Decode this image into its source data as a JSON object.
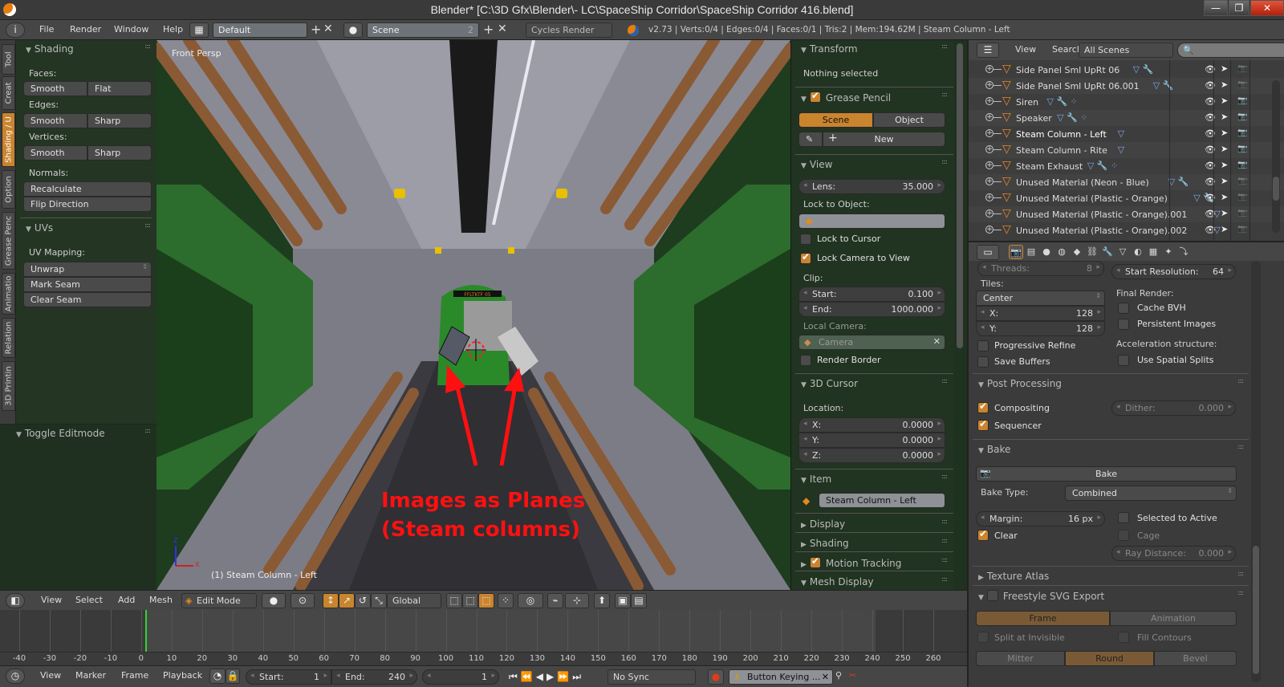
{
  "window": {
    "title": "Blender* [C:\\3D Gfx\\Blender\\- LC\\SpaceShip Corridor\\SpaceShip Corridor 416.blend]",
    "minimize": "—",
    "restore": "❐",
    "close": "✕"
  },
  "info_header": {
    "editor_icon": "i",
    "menus": [
      "File",
      "Render",
      "Window",
      "Help"
    ],
    "screen_layout": "Default",
    "scene": "Scene",
    "scene_users": "2",
    "render_engine": "Cycles Render",
    "stats": "v2.73 | Verts:0/4 | Edges:0/4 | Faces:0/1 | Tris:2 | Mem:194.62M | Steam Column - Left"
  },
  "toolshelf": {
    "tabs": [
      "Tool",
      "Creat",
      "Shading / U",
      "Option",
      "Grease Penc",
      "Animatio",
      "Relation",
      "3D Printin"
    ],
    "active_tab": "Shading / U",
    "shading_panel": {
      "title": "Shading",
      "faces_label": "Faces:",
      "faces_buttons": [
        "Smooth",
        "Flat"
      ],
      "edges_label": "Edges:",
      "edges_buttons": [
        "Smooth",
        "Sharp"
      ],
      "vertices_label": "Vertices:",
      "vertices_buttons": [
        "Smooth",
        "Sharp"
      ],
      "normals_label": "Normals:",
      "recalculate": "Recalculate",
      "flip_direction": "Flip Direction"
    },
    "uvs_panel": {
      "title": "UVs",
      "uv_mapping_label": "UV Mapping:",
      "unwrap": "Unwrap",
      "mark_seam": "Mark Seam",
      "clear_seam": "Clear Seam"
    },
    "operator_panel": {
      "title": "Toggle Editmode"
    }
  },
  "viewport": {
    "view_name": "Front Persp",
    "object_info": "(1) Steam Column - Left",
    "axis_z": "Z",
    "axis_x": "X",
    "annotation_line1": "Images as Planes",
    "annotation_line2": "(Steam columns)",
    "annotation_color": "#ff1010",
    "sign_text": "FFLTKTF 05"
  },
  "npanel": {
    "transform": {
      "title": "Transform",
      "status": "Nothing selected"
    },
    "grease_pencil": {
      "title": "Grease Pencil",
      "enabled": true,
      "tabs": [
        "Scene",
        "Object"
      ],
      "active_tab": "Scene",
      "new_label": "New"
    },
    "view": {
      "title": "View",
      "lens_label": "Lens:",
      "lens_value": "35.000",
      "lock_to_object_label": "Lock to Object:",
      "lock_to_cursor_label": "Lock to Cursor",
      "lock_to_cursor": false,
      "lock_camera_label": "Lock Camera to View",
      "lock_camera": true,
      "clip_label": "Clip:",
      "clip_start_label": "Start:",
      "clip_start": "0.100",
      "clip_end_label": "End:",
      "clip_end": "1000.000",
      "local_camera_label": "Local Camera:",
      "local_camera_value": "Camera",
      "render_border_label": "Render Border",
      "render_border": false
    },
    "cursor": {
      "title": "3D Cursor",
      "location_label": "Location:",
      "x_label": "X:",
      "x": "0.0000",
      "y_label": "Y:",
      "y": "0.0000",
      "z_label": "Z:",
      "z": "0.0000"
    },
    "item": {
      "title": "Item",
      "name": "Steam Column - Left"
    },
    "display": {
      "title": "Display"
    },
    "shading": {
      "title": "Shading"
    },
    "motion_tracking": {
      "title": "Motion Tracking",
      "enabled": true
    },
    "mesh_display": {
      "title": "Mesh Display"
    }
  },
  "v3d_header": {
    "menus": [
      "View",
      "Select",
      "Add",
      "Mesh"
    ],
    "mode": "Edit Mode",
    "orientation": "Global"
  },
  "timeline": {
    "ticks": [
      "-40",
      "-30",
      "-20",
      "-10",
      "0",
      "10",
      "20",
      "30",
      "40",
      "50",
      "60",
      "70",
      "80",
      "90",
      "100",
      "110",
      "120",
      "130",
      "140",
      "150",
      "160",
      "170",
      "180",
      "190",
      "200",
      "210",
      "220",
      "230",
      "240",
      "250",
      "260"
    ],
    "current_frame_marker": "0",
    "menus": [
      "View",
      "Marker",
      "Frame",
      "Playback"
    ],
    "start_label": "Start:",
    "start": "1",
    "end_label": "End:",
    "end": "240",
    "current_frame": "1",
    "sync": "No Sync",
    "keying_set": "Button Keying ..."
  },
  "outliner": {
    "view_menu": "View",
    "search_menu": "Search",
    "display_mode": "All Scenes",
    "search_placeholder": "",
    "rows": [
      {
        "name": "Side Panel Sml UpRt 06",
        "extras": "▽ 🔧",
        "renderable": false
      },
      {
        "name": "Side Panel Sml UpRt 06.001",
        "extras": "▽ 🔧",
        "renderable": false
      },
      {
        "name": "Siren",
        "extras": "▽ 🔧 ⁘",
        "renderable": true
      },
      {
        "name": "Speaker",
        "extras": "▽ 🔧 ⁘",
        "renderable": true
      },
      {
        "name": "Steam Column - Left",
        "extras": "▽",
        "renderable": true
      },
      {
        "name": "Steam Column - Rite",
        "extras": "▽",
        "renderable": true
      },
      {
        "name": "Steam Exhaust",
        "extras": "▽ 🔧 ⁘",
        "renderable": true
      },
      {
        "name": "Unused Material (Neon - Blue)",
        "extras": "▽ 🔧",
        "renderable": false
      },
      {
        "name": "Unused Material (Plastic - Orange)",
        "extras": "▽ 🔧",
        "renderable": false
      },
      {
        "name": "Unused Material (Plastic - Orange).001",
        "extras": "▽",
        "renderable": false
      },
      {
        "name": "Unused Material (Plastic - Orange).002",
        "extras": "▽",
        "renderable": false
      }
    ]
  },
  "properties": {
    "tabs": [
      "render",
      "render-layers",
      "scene",
      "world",
      "object",
      "constraints",
      "modifiers",
      "data",
      "material",
      "texture",
      "particles",
      "physics"
    ],
    "active_tab": "render",
    "threads_label": "Threads:",
    "threads": "8",
    "start_res_label": "Start Resolution:",
    "start_res": "64",
    "tiles_label": "Tiles:",
    "tile_order": "Center",
    "tile_x_label": "X:",
    "tile_x": "128",
    "tile_y_label": "Y:",
    "tile_y": "128",
    "final_render_label": "Final Render:",
    "cache_bvh": "Cache BVH",
    "persistent_images": "Persistent Images",
    "progressive_refine": "Progressive Refine",
    "save_buffers": "Save Buffers",
    "accel_label": "Acceleration structure:",
    "spatial_splits": "Use Spatial Splits",
    "post_processing": {
      "title": "Post Processing",
      "compositing": "Compositing",
      "compositing_on": true,
      "sequencer": "Sequencer",
      "sequencer_on": true,
      "dither_label": "Dither:",
      "dither": "0.000"
    },
    "bake": {
      "title": "Bake",
      "bake_button": "Bake",
      "bake_type_label": "Bake Type:",
      "bake_type": "Combined",
      "margin_label": "Margin:",
      "margin": "16 px",
      "selected_to_active": "Selected to Active",
      "clear": "Clear",
      "clear_on": true,
      "cage": "Cage",
      "ray_distance_label": "Ray Distance:",
      "ray_distance": "0.000"
    },
    "texture_atlas": {
      "title": "Texture Atlas"
    },
    "freestyle_svg": {
      "title": "Freestyle SVG Export",
      "modes": [
        "Frame",
        "Animation"
      ],
      "active_mode": "Frame",
      "split_at_invisible": "Split at Invisible",
      "fill_contours": "Fill Contours",
      "joins": [
        "Mitter",
        "Round",
        "Bevel"
      ],
      "active_join": "Round"
    }
  }
}
